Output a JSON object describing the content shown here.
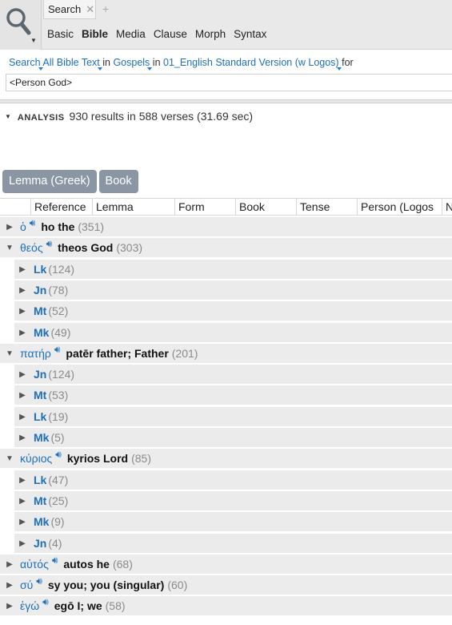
{
  "tab": {
    "title": "Search",
    "close": "✕",
    "add": "+"
  },
  "modes": [
    "Basic",
    "Bible",
    "Media",
    "Clause",
    "Morph",
    "Syntax"
  ],
  "active_mode": "Bible",
  "search_line": {
    "search": "Search",
    "scope": "All Bible Text",
    "in1": "in",
    "range": "Gospels",
    "in2": "in",
    "version": "01_English Standard Version (w Logos)",
    "for": "for"
  },
  "query": "<Person God>",
  "analysis": {
    "label": "ANALYSIS",
    "summary": "930 results in 588 verses (31.69 sec)"
  },
  "group_buttons": [
    "Lemma (Greek)",
    "Book"
  ],
  "columns": [
    "Reference",
    "Lemma",
    "Form",
    "Book",
    "Tense",
    "Person (Logos",
    "N"
  ],
  "results": [
    {
      "greek": "ὁ",
      "gloss": "ho the",
      "count": "(351)",
      "expanded": false,
      "books": []
    },
    {
      "greek": "θεός",
      "gloss": "theos God",
      "count": "(303)",
      "expanded": true,
      "books": [
        {
          "name": "Lk",
          "count": "(124)"
        },
        {
          "name": "Jn",
          "count": "(78)"
        },
        {
          "name": "Mt",
          "count": "(52)"
        },
        {
          "name": "Mk",
          "count": "(49)"
        }
      ]
    },
    {
      "greek": "πατήρ",
      "gloss": "patēr father; Father",
      "count": "(201)",
      "expanded": true,
      "books": [
        {
          "name": "Jn",
          "count": "(124)"
        },
        {
          "name": "Mt",
          "count": "(53)"
        },
        {
          "name": "Lk",
          "count": "(19)"
        },
        {
          "name": "Mk",
          "count": "(5)"
        }
      ]
    },
    {
      "greek": "κύριος",
      "gloss": "kyrios Lord",
      "count": "(85)",
      "expanded": true,
      "books": [
        {
          "name": "Lk",
          "count": "(47)"
        },
        {
          "name": "Mt",
          "count": "(25)"
        },
        {
          "name": "Mk",
          "count": "(9)"
        },
        {
          "name": "Jn",
          "count": "(4)"
        }
      ]
    },
    {
      "greek": "αὐτός",
      "gloss": "autos he",
      "count": "(68)",
      "expanded": false,
      "books": []
    },
    {
      "greek": "σύ",
      "gloss": "sy you; you (singular)",
      "count": "(60)",
      "expanded": false,
      "books": []
    },
    {
      "greek": "ἐγώ",
      "gloss": "egō I; we",
      "count": "(58)",
      "expanded": false,
      "books": []
    }
  ],
  "icons": {
    "search": "magnifier-icon",
    "speaker": "speaker-icon",
    "collapsed": "triangle-right-icon",
    "expanded": "triangle-down-icon"
  },
  "colors": {
    "link": "#1d6fb8",
    "button": "#8a96a3",
    "row": "#ececec",
    "count": "#8a8a8a"
  }
}
